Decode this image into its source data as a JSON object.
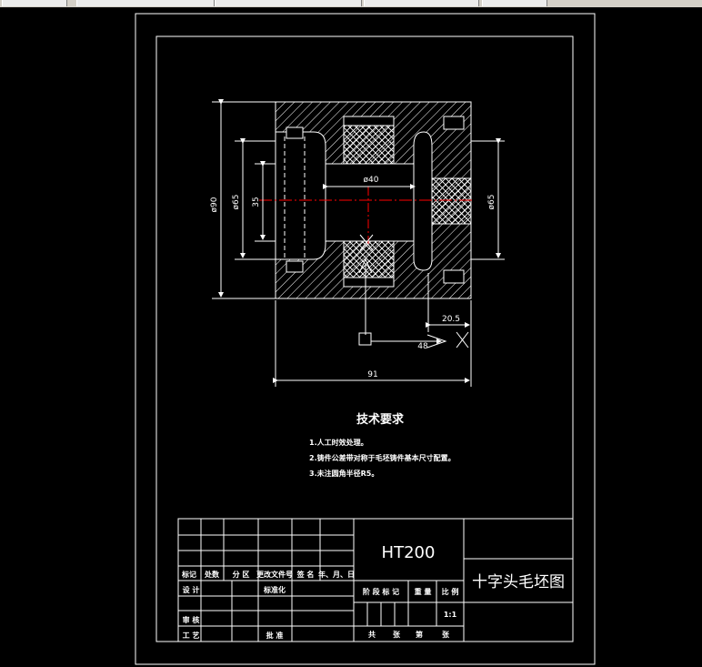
{
  "drawing": {
    "dimensions": {
      "d90": "ø90",
      "d65_left": "ø65",
      "d35": "35",
      "d40": "ø40",
      "d65_right": "ø65",
      "d20_5": "20.5",
      "d48": "48",
      "d91": "91"
    }
  },
  "notes": {
    "title": "技术要求",
    "items": [
      "1.人工时效处理。",
      "2.铸件公差带对称于毛坯铸件基本尺寸配置。",
      "3.未注圆角半径R5。"
    ]
  },
  "title_block": {
    "material": "HT200",
    "part_name": "十字头毛坯图",
    "revision_headers": [
      "标记",
      "处数",
      "分 区",
      "更改文件号",
      "签 名",
      "年、月、日"
    ],
    "design": "设 计",
    "standardize": "标准化",
    "review": "审 核",
    "process": "工 艺",
    "approve": "批 准",
    "stage_mark": "阶 段 标 记",
    "weight": "重 量",
    "scale_label": "比 例",
    "scale_value": "1:1",
    "total": "共",
    "sheets": "张",
    "page": "第",
    "sheets2": "张"
  },
  "colors": {
    "background": "#000000",
    "lines": "#ffffff",
    "centerline": "#ff0000"
  }
}
